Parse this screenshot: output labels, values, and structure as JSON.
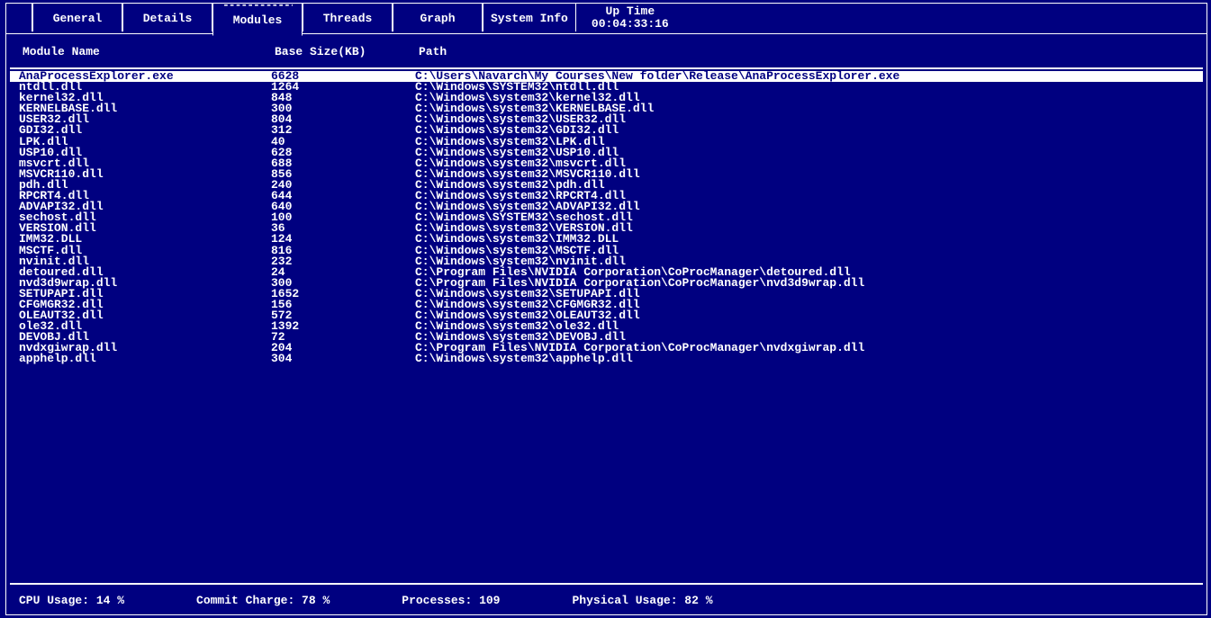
{
  "tabs": [
    {
      "label": "General"
    },
    {
      "label": "Details"
    },
    {
      "label": "Modules",
      "selected": true
    },
    {
      "label": "Threads"
    },
    {
      "label": "Graph"
    },
    {
      "label": "System Info"
    }
  ],
  "uptime": {
    "label": "Up Time",
    "value": "00:04:33:16"
  },
  "headers": {
    "name": "Module Name",
    "size": "Base Size(KB)",
    "path": "Path"
  },
  "modules": [
    {
      "name": "AnaProcessExplorer.exe",
      "size": "6628",
      "path": "C:\\Users\\Navarch\\My Courses\\New folder\\Release\\AnaProcessExplorer.exe",
      "selected": true
    },
    {
      "name": "ntdll.dll",
      "size": "1264",
      "path": "C:\\Windows\\SYSTEM32\\ntdll.dll"
    },
    {
      "name": "kernel32.dll",
      "size": "848",
      "path": "C:\\Windows\\system32\\kernel32.dll"
    },
    {
      "name": "KERNELBASE.dll",
      "size": "300",
      "path": "C:\\Windows\\system32\\KERNELBASE.dll"
    },
    {
      "name": "USER32.dll",
      "size": "804",
      "path": "C:\\Windows\\system32\\USER32.dll"
    },
    {
      "name": "GDI32.dll",
      "size": "312",
      "path": "C:\\Windows\\system32\\GDI32.dll"
    },
    {
      "name": "LPK.dll",
      "size": "40",
      "path": "C:\\Windows\\system32\\LPK.dll"
    },
    {
      "name": "USP10.dll",
      "size": "628",
      "path": "C:\\Windows\\system32\\USP10.dll"
    },
    {
      "name": "msvcrt.dll",
      "size": "688",
      "path": "C:\\Windows\\system32\\msvcrt.dll"
    },
    {
      "name": "MSVCR110.dll",
      "size": "856",
      "path": "C:\\Windows\\system32\\MSVCR110.dll"
    },
    {
      "name": "pdh.dll",
      "size": "240",
      "path": "C:\\Windows\\system32\\pdh.dll"
    },
    {
      "name": "RPCRT4.dll",
      "size": "644",
      "path": "C:\\Windows\\system32\\RPCRT4.dll"
    },
    {
      "name": "ADVAPI32.dll",
      "size": "640",
      "path": "C:\\Windows\\system32\\ADVAPI32.dll"
    },
    {
      "name": "sechost.dll",
      "size": "100",
      "path": "C:\\Windows\\SYSTEM32\\sechost.dll"
    },
    {
      "name": "VERSION.dll",
      "size": "36",
      "path": "C:\\Windows\\system32\\VERSION.dll"
    },
    {
      "name": "IMM32.DLL",
      "size": "124",
      "path": "C:\\Windows\\system32\\IMM32.DLL"
    },
    {
      "name": "MSCTF.dll",
      "size": "816",
      "path": "C:\\Windows\\system32\\MSCTF.dll"
    },
    {
      "name": "nvinit.dll",
      "size": "232",
      "path": "C:\\Windows\\system32\\nvinit.dll"
    },
    {
      "name": "detoured.dll",
      "size": "24",
      "path": "C:\\Program Files\\NVIDIA Corporation\\CoProcManager\\detoured.dll"
    },
    {
      "name": "nvd3d9wrap.dll",
      "size": "300",
      "path": "C:\\Program Files\\NVIDIA Corporation\\CoProcManager\\nvd3d9wrap.dll"
    },
    {
      "name": "SETUPAPI.dll",
      "size": "1652",
      "path": "C:\\Windows\\system32\\SETUPAPI.dll"
    },
    {
      "name": "CFGMGR32.dll",
      "size": "156",
      "path": "C:\\Windows\\system32\\CFGMGR32.dll"
    },
    {
      "name": "OLEAUT32.dll",
      "size": "572",
      "path": "C:\\Windows\\system32\\OLEAUT32.dll"
    },
    {
      "name": "ole32.dll",
      "size": "1392",
      "path": "C:\\Windows\\system32\\ole32.dll"
    },
    {
      "name": "DEVOBJ.dll",
      "size": "72",
      "path": "C:\\Windows\\system32\\DEVOBJ.dll"
    },
    {
      "name": "nvdxgiwrap.dll",
      "size": "204",
      "path": "C:\\Program Files\\NVIDIA Corporation\\CoProcManager\\nvdxgiwrap.dll"
    },
    {
      "name": "apphelp.dll",
      "size": "304",
      "path": "C:\\Windows\\system32\\apphelp.dll"
    }
  ],
  "status": {
    "cpu": "CPU Usage: 14 %",
    "commit": "Commit Charge: 78 %",
    "processes": "Processes: 109",
    "physical": "Physical Usage: 82 %"
  }
}
